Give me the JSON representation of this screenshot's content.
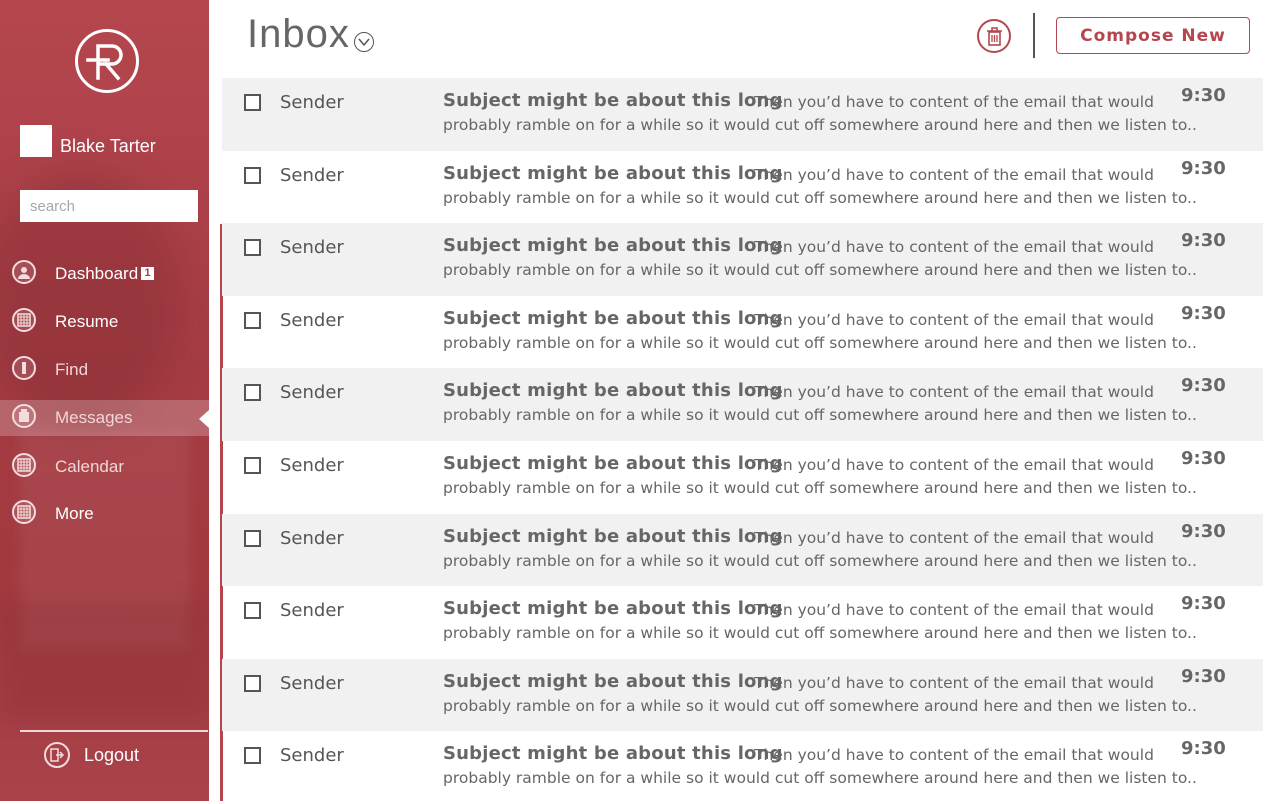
{
  "user": {
    "name": "Blake Tarter"
  },
  "search": {
    "placeholder": "search"
  },
  "sidebar": {
    "items": [
      {
        "label": "Dashboard",
        "badge": "1",
        "icon": "user-icon"
      },
      {
        "label": "Resume",
        "icon": "grid-icon"
      },
      {
        "label": "Find",
        "icon": "bar-icon"
      },
      {
        "label": "Messages",
        "icon": "messages-icon"
      },
      {
        "label": "Calendar",
        "icon": "calendar-icon"
      },
      {
        "label": "More",
        "icon": "grid-icon"
      }
    ],
    "logout_label": "Logout"
  },
  "header": {
    "title": "Inbox",
    "compose_label": "Compose New"
  },
  "colors": {
    "accent": "#b5464e",
    "row_shade": "#f1f1f1"
  },
  "emails": [
    {
      "sender": "Sender",
      "subject": "Subject might be about this long",
      "preview_line1": "Then you’d have to content of the email that would",
      "preview_line2": "probably ramble on for a while so it would cut off somewhere around here and then we listen to..",
      "time": "9:30"
    },
    {
      "sender": "Sender",
      "subject": "Subject might be about this long",
      "preview_line1": "Then you’d have to content of the email that would",
      "preview_line2": "probably ramble on for a while so it would cut off somewhere around here and then we listen to..",
      "time": "9:30"
    },
    {
      "sender": "Sender",
      "subject": "Subject might be about this long",
      "preview_line1": "Then you’d have to content of the email that would",
      "preview_line2": "probably ramble on for a while so it would cut off somewhere around here and then we listen to..",
      "time": "9:30"
    },
    {
      "sender": "Sender",
      "subject": "Subject might be about this long",
      "preview_line1": "Then you’d have to content of the email that would",
      "preview_line2": "probably ramble on for a while so it would cut off somewhere around here and then we listen to..",
      "time": "9:30"
    },
    {
      "sender": "Sender",
      "subject": "Subject might be about this long",
      "preview_line1": "Then you’d have to content of the email that would",
      "preview_line2": "probably ramble on for a while so it would cut off somewhere around here and then we listen to..",
      "time": "9:30"
    },
    {
      "sender": "Sender",
      "subject": "Subject might be about this long",
      "preview_line1": "Then you’d have to content of the email that would",
      "preview_line2": "probably ramble on for a while so it would cut off somewhere around here and then we listen to..",
      "time": "9:30"
    },
    {
      "sender": "Sender",
      "subject": "Subject might be about this long",
      "preview_line1": "Then you’d have to content of the email that would",
      "preview_line2": "probably ramble on for a while so it would cut off somewhere around here and then we listen to..",
      "time": "9:30"
    },
    {
      "sender": "Sender",
      "subject": "Subject might be about this long",
      "preview_line1": "Then you’d have to content of the email that would",
      "preview_line2": "probably ramble on for a while so it would cut off somewhere around here and then we listen to..",
      "time": "9:30"
    },
    {
      "sender": "Sender",
      "subject": "Subject might be about this long",
      "preview_line1": "Then you’d have to content of the email that would",
      "preview_line2": "probably ramble on for a while so it would cut off somewhere around here and then we listen to..",
      "time": "9:30"
    },
    {
      "sender": "Sender",
      "subject": "Subject might be about this long",
      "preview_line1": "Then you’d have to content of the email that would",
      "preview_line2": "probably ramble on for a while so it would cut off somewhere around here and then we listen to..",
      "time": "9:30"
    }
  ]
}
